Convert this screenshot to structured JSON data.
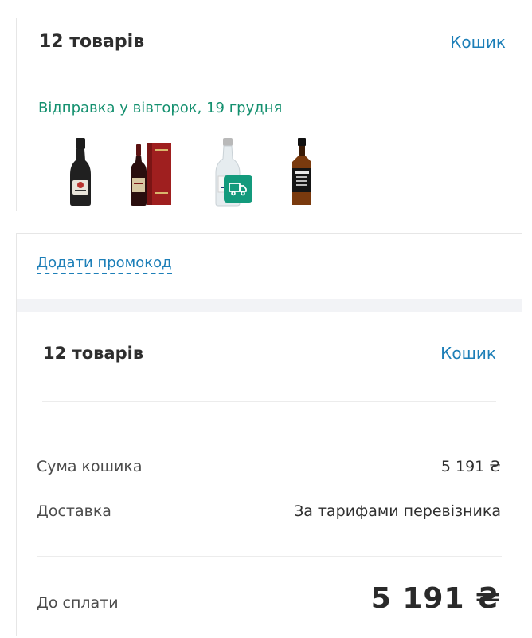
{
  "cart_card": {
    "title": "12 товарів",
    "cart_link": "Кошик",
    "shipping_text": "Відправка у вівторок, 19 грудня",
    "products": [
      {
        "name": "sparkling-wine-bottle"
      },
      {
        "name": "red-wine-bottle-with-box"
      },
      {
        "name": "white-vermouth-bottle"
      },
      {
        "name": "whiskey-bottle"
      }
    ],
    "badge_icon": "truck-icon",
    "accent_color": "#139a7c"
  },
  "summary_card": {
    "promo_link": "Додати промокод",
    "title": "12 товарів",
    "cart_link": "Кошик",
    "cart_sum_label": "Сума кошика",
    "cart_sum_value": "5 191 ₴",
    "delivery_label": "Доставка",
    "delivery_value": "За тарифами перевізника",
    "total_label": "До сплати",
    "total_value": "5 191 ₴",
    "link_color": "#1d7fb8"
  }
}
